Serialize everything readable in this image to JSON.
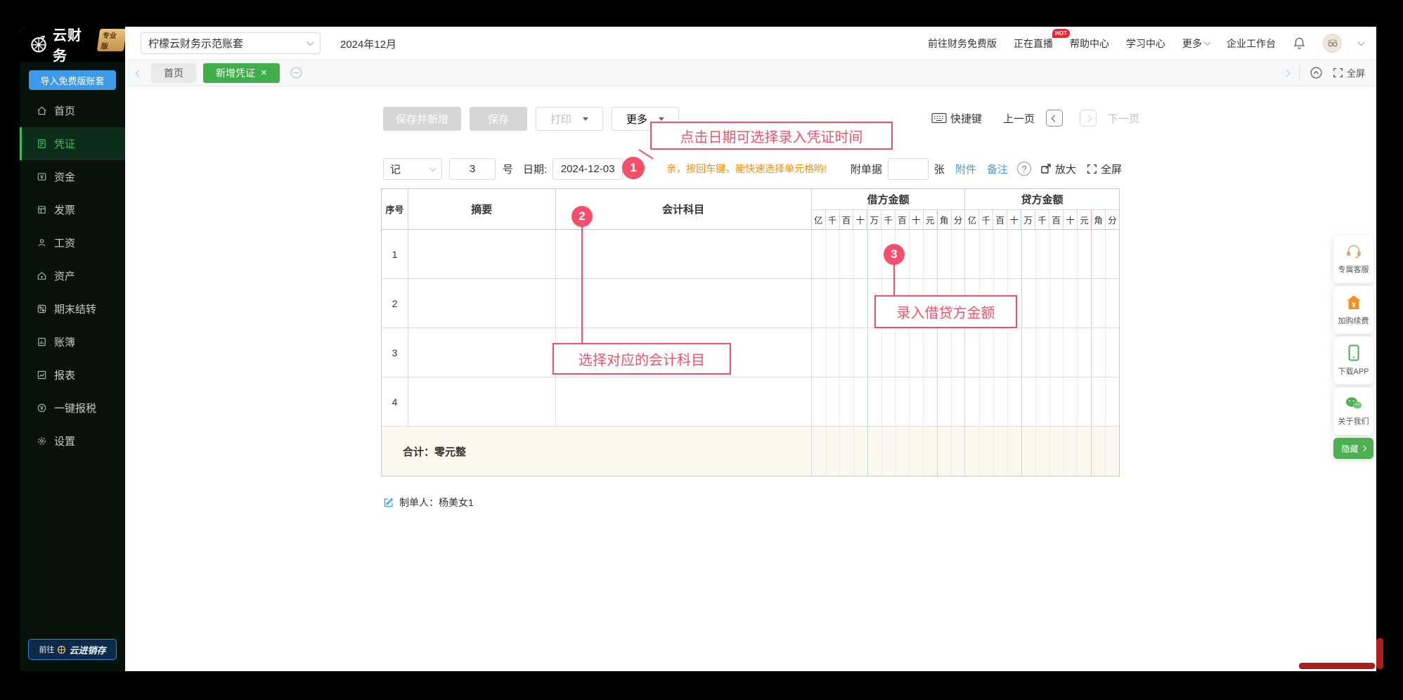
{
  "brand": {
    "name": "云财务",
    "badge": "专业版",
    "import_btn": "导入免费版账套",
    "cloud_btn_prefix": "前往",
    "cloud_btn_name": "云进销存"
  },
  "topbar": {
    "account": "柠檬云财务示范账套",
    "period": "2024年12月",
    "link_free": "前往财务免费版",
    "link_live": "正在直播",
    "hot": "HOT",
    "link_help": "帮助中心",
    "link_learn": "学习中心",
    "link_more": "更多",
    "link_workbench": "企业工作台"
  },
  "tabbar": {
    "tab_home": "首页",
    "tab_new_voucher": "新增凭证",
    "close": "×",
    "fullscreen": "全屏"
  },
  "sidebar": {
    "items": [
      {
        "label": "首页"
      },
      {
        "label": "凭证"
      },
      {
        "label": "资金"
      },
      {
        "label": "发票"
      },
      {
        "label": "工资"
      },
      {
        "label": "资产"
      },
      {
        "label": "期末结转"
      },
      {
        "label": "账簿"
      },
      {
        "label": "报表"
      },
      {
        "label": "一键报税"
      },
      {
        "label": "设置"
      }
    ]
  },
  "toolbar": {
    "save_new": "保存并新增",
    "save": "保存",
    "print": "打印",
    "more": "更多",
    "shortcut": "快捷键",
    "prev": "上一页",
    "next": "下一页"
  },
  "voucher": {
    "type": "记",
    "number": "3",
    "number_suffix": "号",
    "date_label": "日期:",
    "date": "2024-12-03",
    "tip": "亲，按回车键，能快速选择单元格哟!",
    "attach_label": "附单据",
    "attach_unit": "张",
    "attachment_link": "附件",
    "note_link": "备注",
    "zoom_label": "放大",
    "fullscreen_label": "全屏"
  },
  "table": {
    "headers": {
      "seq": "序号",
      "summary": "摘要",
      "account": "会计科目",
      "debit": "借方金额",
      "credit": "贷方金额"
    },
    "digits": [
      "亿",
      "千",
      "百",
      "十",
      "万",
      "千",
      "百",
      "十",
      "元",
      "角",
      "分"
    ],
    "rows": [
      {
        "num": "1"
      },
      {
        "num": "2"
      },
      {
        "num": "3"
      },
      {
        "num": "4"
      }
    ],
    "total_label": "合计：零元整"
  },
  "annotations": {
    "step1": {
      "num": "1",
      "text": "点击日期可选择录入凭证时间"
    },
    "step2": {
      "num": "2",
      "text": "选择对应的会计科目"
    },
    "step3": {
      "num": "3",
      "text": "录入借贷方金额"
    }
  },
  "footer": {
    "creator": "制单人：杨美女1"
  },
  "float_menu": {
    "service": "专属客服",
    "renew": "加购续费",
    "app": "下载APP",
    "about": "关于我们",
    "hide": "隐藏"
  },
  "colors": {
    "accent_green": "#3fae4b",
    "annotation_red": "#f5506b",
    "link_blue": "#3d9ae8",
    "tip_orange": "#ff8a00",
    "scroll_red": "#a92019"
  }
}
